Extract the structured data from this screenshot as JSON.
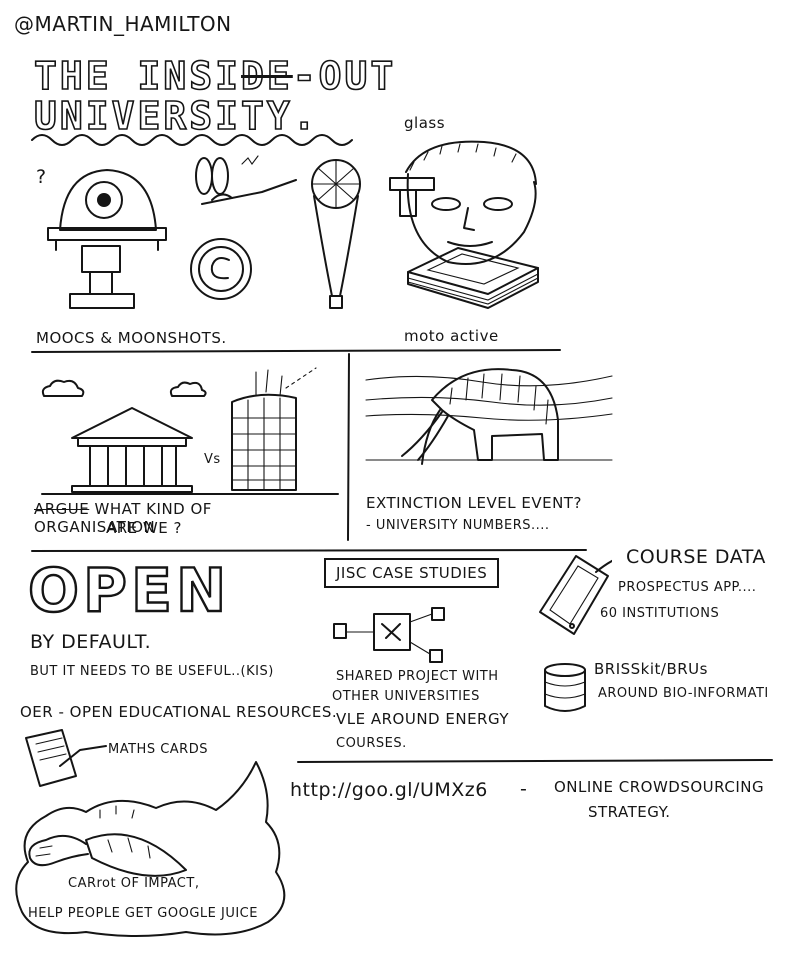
{
  "handle": "@MARTIN_HAMILTON",
  "title": {
    "line1_a": "THE INSI",
    "line1_struck": "DE",
    "line1_b": "-OUT",
    "line2": "UNIVERSITY."
  },
  "panel_moocs": {
    "question_mark": "?",
    "caption": "MOOCS & MOONSHOTS."
  },
  "panel_glass": {
    "glass_label": "glass",
    "moto_label": "moto active"
  },
  "panel_organisation": {
    "vs": "Vs",
    "caption_struck": "ARGUE",
    "caption_line1": "WHAT KIND OF ORGANISATION",
    "caption_line2": "ARE WE ?"
  },
  "panel_extinction": {
    "caption_line1": "EXTINCTION LEVEL EVENT?",
    "caption_line2": "- UNIVERSITY NUMBERS...."
  },
  "open_section": {
    "open_word": "OPEN",
    "by_default": "BY DEFAULT.",
    "useful_line": "BUT IT NEEDS TO BE USEFUL..(KIS)",
    "oer_line": "OER - OPEN EDUCATIONAL RESOURCES.",
    "maths_cards": "MATHS CARDS"
  },
  "jisc_section": {
    "box_title": "JISC CASE STUDIES",
    "line1": "SHARED PROJECT WITH",
    "line2": "OTHER UNIVERSITIES",
    "line3": "VLE AROUND ENERGY",
    "line4": "COURSES."
  },
  "course_data_section": {
    "title": "COURSE DATA",
    "line1": "PROSPECTUS APP....",
    "line2": "60 INSTITUTIONS"
  },
  "brisskit_section": {
    "title": "BRISSkit/BRUs",
    "line1": "AROUND BIO-INFORMATI"
  },
  "cloud_section": {
    "carrot_line1": "CARrot OF IMPACT,",
    "carrot_line2": "HELP PEOPLE GET GOOGLE JUICE",
    "url": "http://goo.gl/UMXz6",
    "dash": "-",
    "strategy_line1": "ONLINE CROWDSOURCING",
    "strategy_line2": "STRATEGY."
  },
  "icons": [
    "robot-camera-icon",
    "dragonfly-drone-icon",
    "copyright-icon",
    "balloon-icon",
    "glass-face-icon",
    "tablet-stack-icon",
    "temple-icon",
    "skyscraper-icon",
    "cloud-icon",
    "mammoth-icon",
    "tablet-device-icon",
    "database-icon",
    "document-icon",
    "carrot-icon",
    "network-cubes-icon"
  ]
}
